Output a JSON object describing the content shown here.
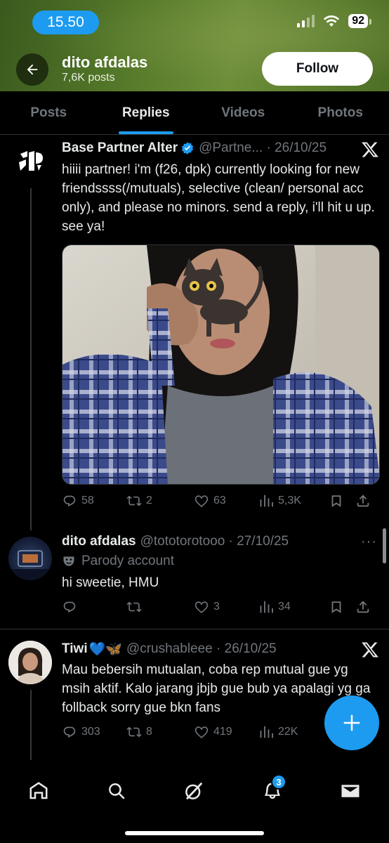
{
  "status_bar": {
    "time": "15.50",
    "battery": "92"
  },
  "header": {
    "name": "dito afdalas",
    "posts_count": "7,6K posts",
    "follow_label": "Follow"
  },
  "tabs": [
    {
      "label": "Posts"
    },
    {
      "label": "Replies",
      "active": true
    },
    {
      "label": "Videos"
    },
    {
      "label": "Photos"
    }
  ],
  "posts": [
    {
      "name": "Base Partner Alter",
      "verified": true,
      "handle_date": "@Partne... · 26/10/25",
      "text": "hiiii partner! i'm (f26, dpk) currently looking for new friendssss(/mutuals), selective (clean/ personal acc only), and please no minors. send a reply, i'll hit u up. see ya!",
      "replies": "58",
      "reposts": "2",
      "likes": "63",
      "views": "5,3K"
    },
    {
      "name": "dito afdalas",
      "handle_date": "@tototorotooo · 27/10/25",
      "label": "Parody account",
      "text": "hi sweetie, HMU",
      "replies": "",
      "reposts": "",
      "likes": "3",
      "views": "34"
    },
    {
      "name": "Tiwi",
      "name_emojis": "💙🦋",
      "handle_date": "@crushableee · 26/10/25",
      "text": "Mau bebersih mutualan, coba rep mutual gue yg msih aktif. Kalo jarang jbjb gue bub ya apalagi yg ga follback sorry gue bkn fans",
      "replies": "303",
      "reposts": "8",
      "likes": "419",
      "views": "22K"
    }
  ],
  "nav": {
    "notifications_badge": "3"
  },
  "colors": {
    "accent": "#1d9bf0",
    "background": "#000000",
    "muted": "#71767b"
  }
}
